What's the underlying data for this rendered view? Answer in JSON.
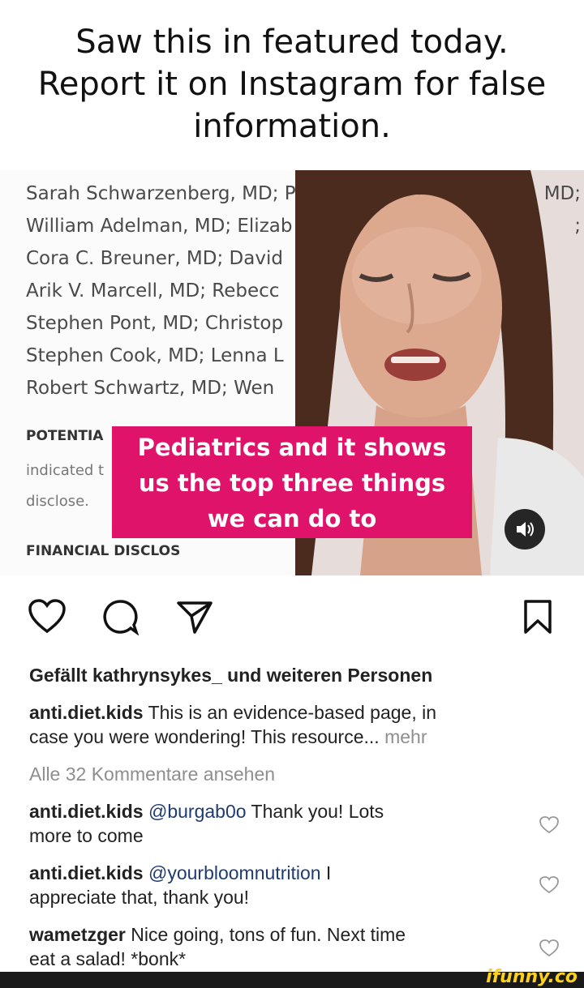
{
  "meme": {
    "title_lines": [
      "Saw this in featured today.",
      "Report it on Instagram for false",
      "information."
    ]
  },
  "media": {
    "doc_lines": [
      "Sarah Schwarzenberg, MD; P",
      "William Adelman, MD; Elizab",
      "Cora C. Breuner, MD; David",
      "Arik V. Marcell, MD; Rebecc",
      "Stephen Pont, MD; Christop",
      "Stephen Cook, MD; Lenna L",
      "Robert Schwartz, MD; Wen"
    ],
    "doc_right": [
      "MD;",
      ";"
    ],
    "potential_label": "POTENTIA",
    "indicated_text": "indicated t",
    "disclose_text": "disclose.",
    "financial_label": "FINANCIAL DISCLOS",
    "caption_lines": [
      "Pediatrics and it shows",
      "us the top three things",
      "we can do to"
    ],
    "sound_icon": "speaker-icon"
  },
  "actions": {
    "icons": [
      "heart-icon",
      "comment-icon",
      "share-icon",
      "bookmark-icon"
    ]
  },
  "post": {
    "likes_text": "Gefällt kathrynsykes_ und weiteren Personen",
    "caption_user": "anti.diet.kids",
    "caption_text": " This is an evidence-based page, in",
    "caption_text_2": "case you were wondering! This resource...",
    "more_label": " mehr",
    "view_all_label": "Alle 32 Kommentare ansehen"
  },
  "comments": [
    {
      "user": "anti.diet.kids",
      "mention": "@burgab0o",
      "text_1": " Thank you! Lots",
      "text_2": "more to come"
    },
    {
      "user": "anti.diet.kids",
      "mention": "@yourbloomnutrition",
      "text_1": " I",
      "text_2": "appreciate that, thank you!"
    },
    {
      "user": "wametzger",
      "mention": "",
      "text_1": " Nice going, tons of fun. Next time",
      "text_2": "eat a salad! *bonk*"
    }
  ],
  "watermark": "ifunny.co",
  "colors": {
    "caption_bg": "#e0136b",
    "brand": "#ffd21a",
    "link": "#1f3b73"
  }
}
